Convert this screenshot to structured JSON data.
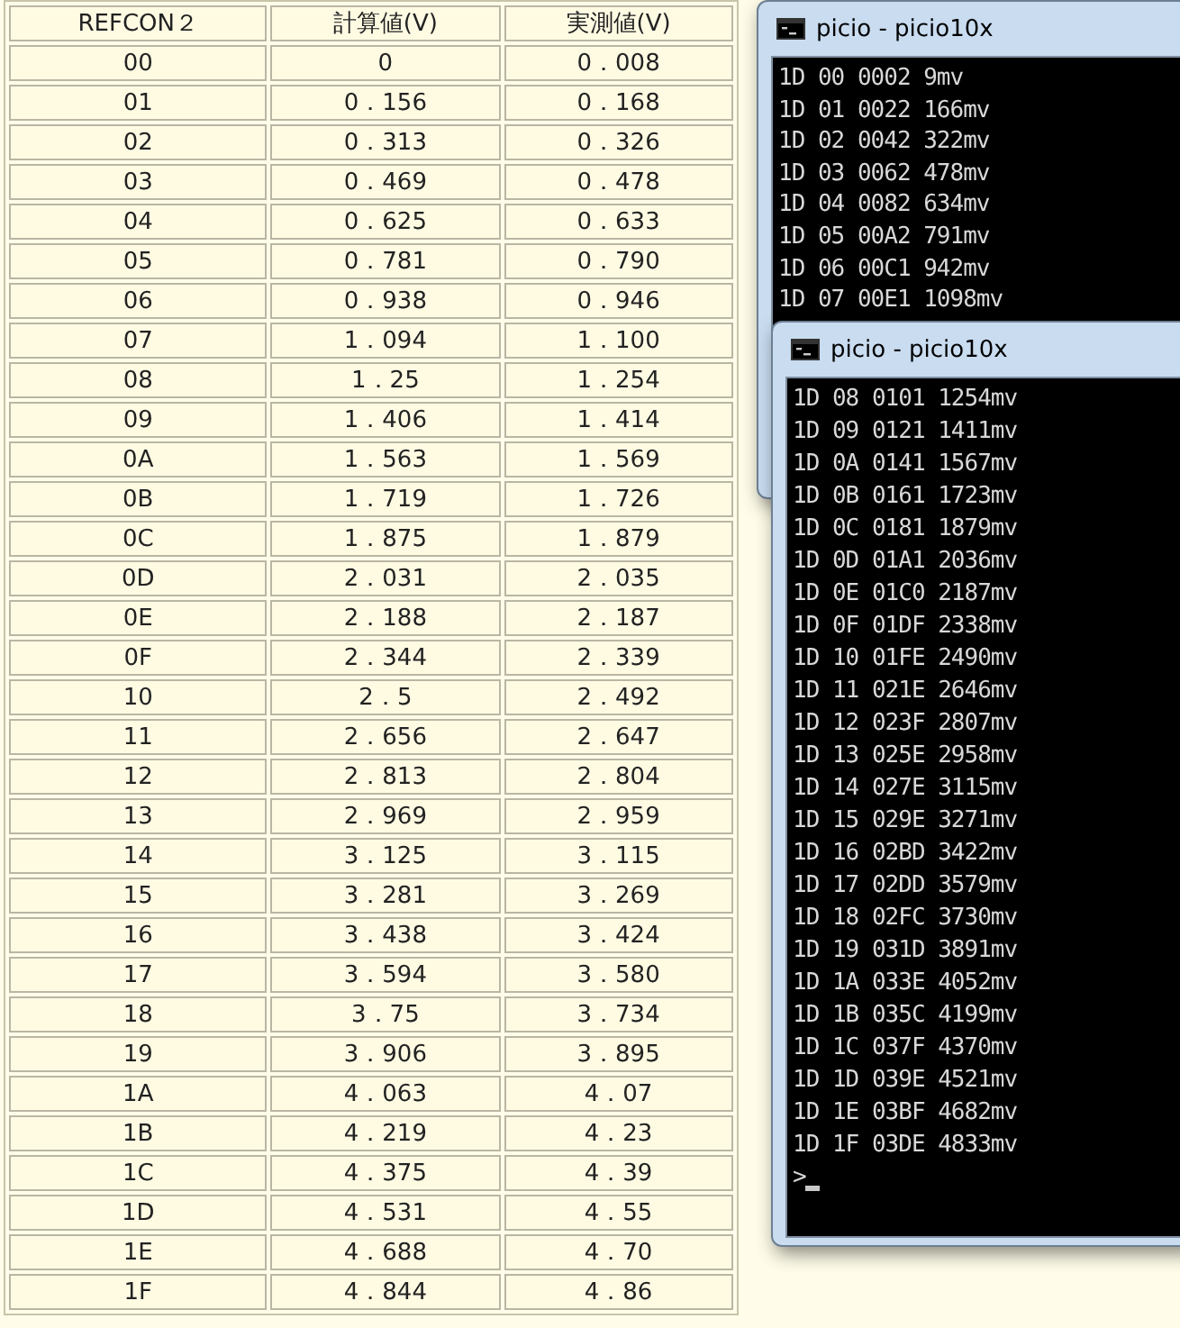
{
  "table": {
    "columns": [
      "REFCON２",
      "計算値(V)",
      "実測値(V)"
    ],
    "rows": [
      [
        "00",
        "0",
        "0．008"
      ],
      [
        "01",
        "0．156",
        "0．168"
      ],
      [
        "02",
        "0．313",
        "0．326"
      ],
      [
        "03",
        "0．469",
        "0．478"
      ],
      [
        "04",
        "0．625",
        "0．633"
      ],
      [
        "05",
        "0．781",
        "0．790"
      ],
      [
        "06",
        "0．938",
        "0．946"
      ],
      [
        "07",
        "1．094",
        "1．100"
      ],
      [
        "08",
        "1．25",
        "1．254"
      ],
      [
        "09",
        "1．406",
        "1．414"
      ],
      [
        "0A",
        "1．563",
        "1．569"
      ],
      [
        "0B",
        "1．719",
        "1．726"
      ],
      [
        "0C",
        "1．875",
        "1．879"
      ],
      [
        "0D",
        "2．031",
        "2．035"
      ],
      [
        "0E",
        "2．188",
        "2．187"
      ],
      [
        "0F",
        "2．344",
        "2．339"
      ],
      [
        "10",
        "2．5",
        "2．492"
      ],
      [
        "11",
        "2．656",
        "2．647"
      ],
      [
        "12",
        "2．813",
        "2．804"
      ],
      [
        "13",
        "2．969",
        "2．959"
      ],
      [
        "14",
        "3．125",
        "3．115"
      ],
      [
        "15",
        "3．281",
        "3．269"
      ],
      [
        "16",
        "3．438",
        "3．424"
      ],
      [
        "17",
        "3．594",
        "3．580"
      ],
      [
        "18",
        "3．75",
        "3．734"
      ],
      [
        "19",
        "3．906",
        "3．895"
      ],
      [
        "1A",
        "4．063",
        "4．07"
      ],
      [
        "1B",
        "4．219",
        "4．23"
      ],
      [
        "1C",
        "4．375",
        "4．39"
      ],
      [
        "1D",
        "4．531",
        "4．55"
      ],
      [
        "1E",
        "4．688",
        "4．70"
      ],
      [
        "1F",
        "4．844",
        "4．86"
      ]
    ]
  },
  "consoles": [
    {
      "title": "picio - picio10x",
      "lines": [
        "1D 00 0002 9mv",
        "1D 01 0022 166mv",
        "1D 02 0042 322mv",
        "1D 03 0062 478mv",
        "1D 04 0082 634mv",
        "1D 05 00A2 791mv",
        "1D 06 00C1 942mv",
        "1D 07 00E1 1098mv"
      ]
    },
    {
      "title": "picio - picio10x",
      "lines": [
        "1D 08 0101 1254mv",
        "1D 09 0121 1411mv",
        "1D 0A 0141 1567mv",
        "1D 0B 0161 1723mv",
        "1D 0C 0181 1879mv",
        "1D 0D 01A1 2036mv",
        "1D 0E 01C0 2187mv",
        "1D 0F 01DF 2338mv",
        "1D 10 01FE 2490mv",
        "1D 11 021E 2646mv",
        "1D 12 023F 2807mv",
        "1D 13 025E 2958mv",
        "1D 14 027E 3115mv",
        "1D 15 029E 3271mv",
        "1D 16 02BD 3422mv",
        "1D 17 02DD 3579mv",
        "1D 18 02FC 3730mv",
        "1D 19 031D 3891mv",
        "1D 1A 033E 4052mv",
        "1D 1B 035C 4199mv",
        "1D 1C 037F 4370mv",
        "1D 1D 039E 4521mv",
        "1D 1E 03BF 4682mv",
        "1D 1F 03DE 4833mv"
      ],
      "prompt": ">"
    }
  ]
}
